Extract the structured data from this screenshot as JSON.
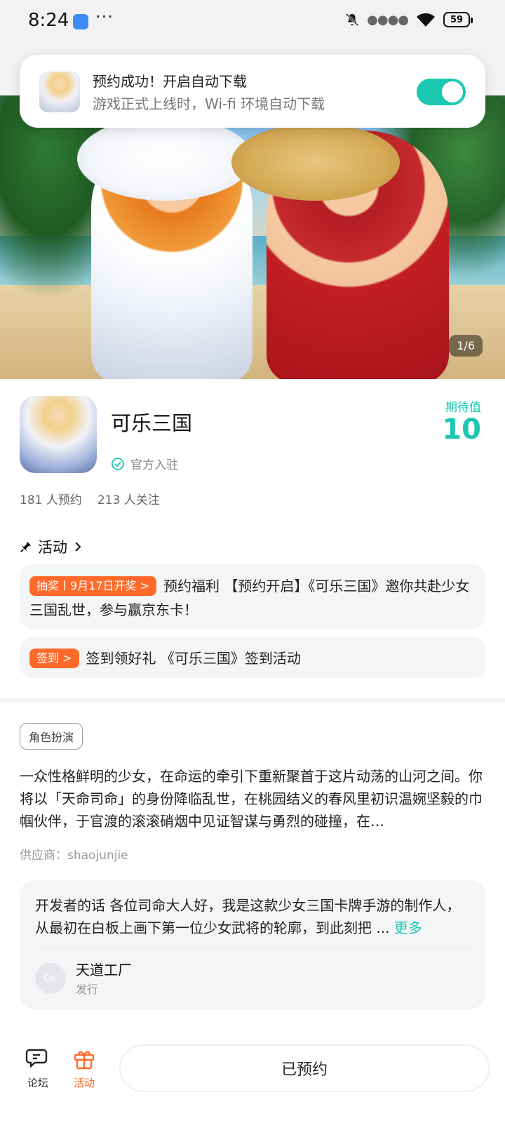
{
  "status_bar": {
    "time": "8:24",
    "dots": "···",
    "battery": "59",
    "icons": [
      "mute-icon",
      "signal-icon",
      "wifi-icon",
      "battery-icon"
    ]
  },
  "notification": {
    "title": "预约成功！开启自动下载",
    "subtitle": "游戏正式上线时，Wi-fi 环境自动下载",
    "toggle_on": true,
    "accent": "#1cc8b2"
  },
  "banner": {
    "page_indicator": "1/6"
  },
  "game": {
    "name": "可乐三国",
    "verified_label": "官方入驻",
    "expect_label": "期待值",
    "expect_value": "10",
    "reservations": "181 人预约",
    "followers": "213 人关注"
  },
  "activity": {
    "section_title": "活动",
    "items": [
      {
        "tag": "抽奖丨9月17日开奖 >",
        "text": "预约福利 【预约开启】《可乐三国》邀你共赴少女三国乱世，参与赢京东卡！"
      },
      {
        "tag": "签到 >",
        "text": "签到领好礼 《可乐三国》签到活动"
      }
    ],
    "tag_color": "#ff6a2a"
  },
  "description": {
    "genre": "角色扮演",
    "text": "一众性格鲜明的少女，在命运的牵引下重新聚首于这片动荡的山河之间。你将以「天命司命」的身份降临乱世，在桃园结义的春风里初识温婉坚毅的巾帼伙伴，于官渡的滚滚硝烟中见证智谋与勇烈的碰撞，在…",
    "supplier": "供应商：shaojunjie"
  },
  "developer": {
    "text": "开发者的话  各位司命大人好，我是这款少女三国卡牌手游的制作人，从最初在白板上画下第一位少女武将的轮廓，到此刻把 ... ",
    "more": "更多",
    "avatar_text": "Co.",
    "name": "天道工厂",
    "role": "发行"
  },
  "bottom_bar": {
    "forum_label": "论坛",
    "activity_label": "活动",
    "reserved_label": "已预约"
  }
}
